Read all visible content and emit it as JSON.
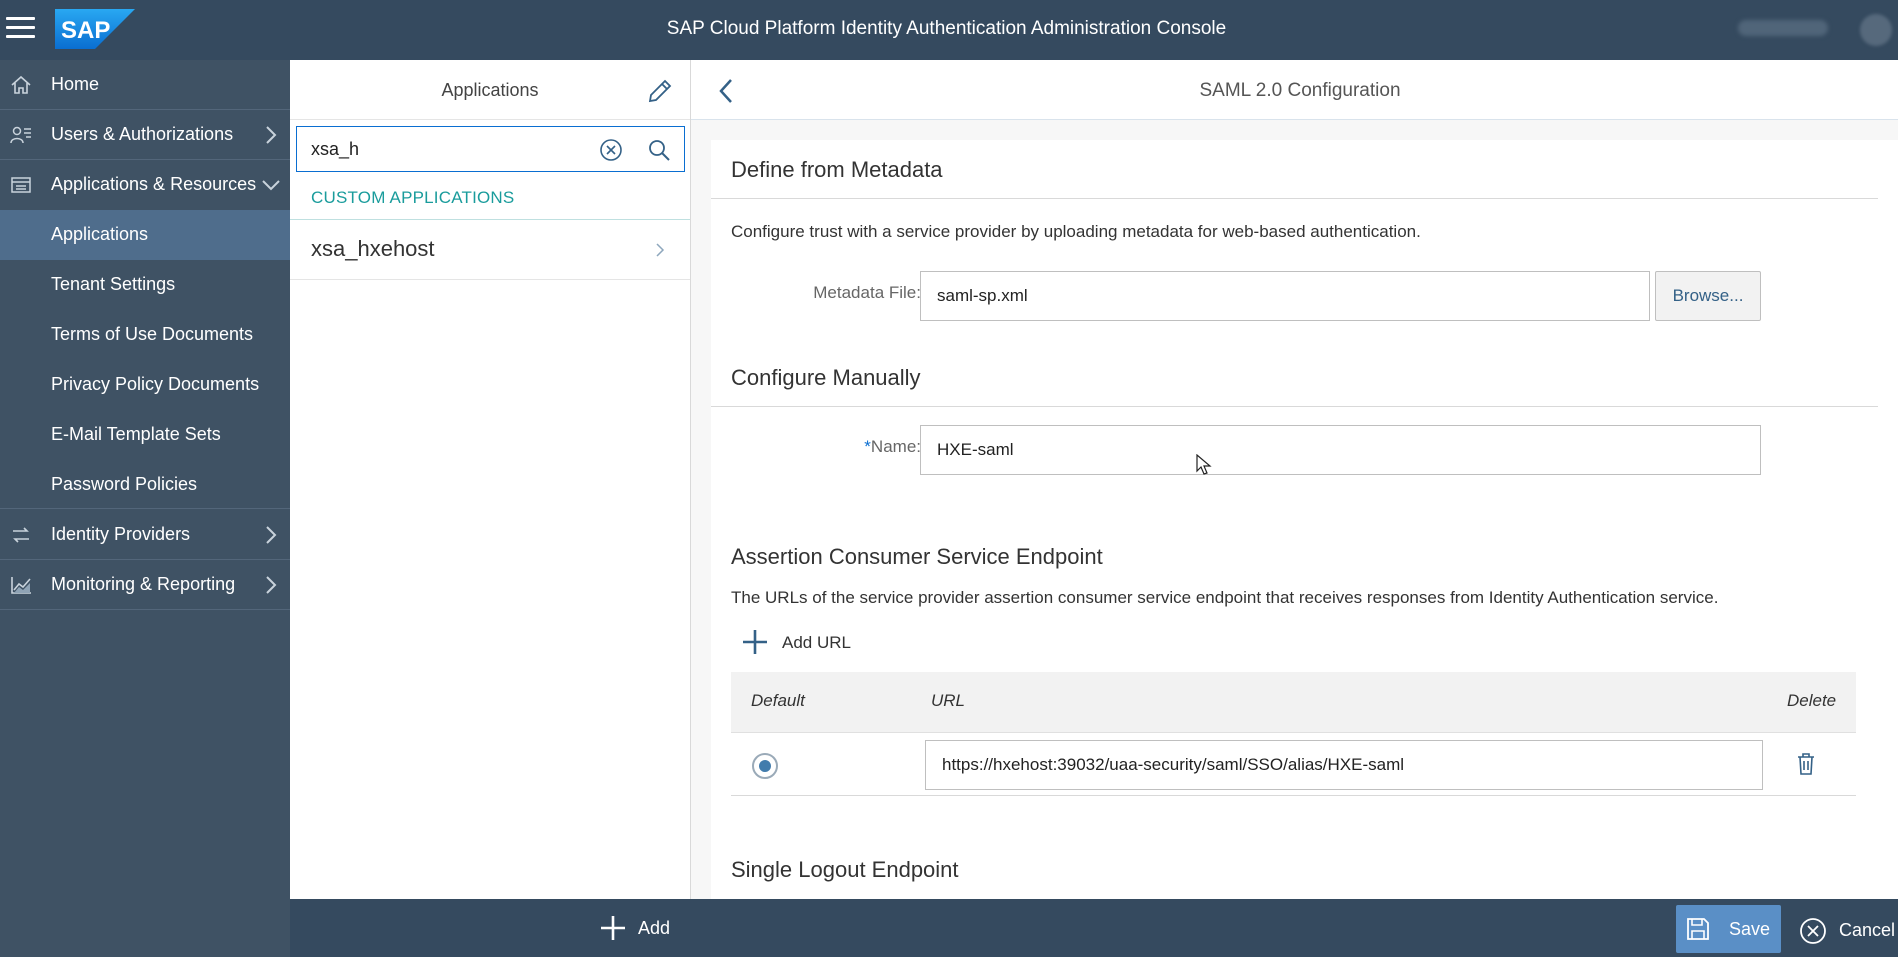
{
  "topbar": {
    "logo_text": "SAP",
    "title": "SAP Cloud Platform Identity Authentication Administration Console",
    "menu_icon": "hamburger-icon",
    "colors": {
      "shell": "#354a5f",
      "logo": "#1f8fe0"
    }
  },
  "sidebar": {
    "items": [
      {
        "label": "Home",
        "icon": "home-icon"
      },
      {
        "label": "Users & Authorizations",
        "icon": "users-icon",
        "chevron": "chevron-right-icon"
      },
      {
        "label": "Applications & Resources",
        "icon": "applications-icon",
        "chevron": "chevron-down-icon",
        "expanded": true
      },
      {
        "label": "Identity Providers",
        "icon": "identity-providers-icon",
        "chevron": "chevron-right-icon"
      },
      {
        "label": "Monitoring & Reporting",
        "icon": "monitoring-icon",
        "chevron": "chevron-right-icon"
      }
    ],
    "subitems": [
      {
        "label": "Applications",
        "active": true
      },
      {
        "label": "Tenant Settings"
      },
      {
        "label": "Terms of Use Documents"
      },
      {
        "label": "Privacy Policy Documents"
      },
      {
        "label": "E-Mail Template Sets"
      },
      {
        "label": "Password Policies"
      }
    ],
    "colors": {
      "background": "#3f5264",
      "active": "#4f6d8c"
    }
  },
  "list_panel": {
    "title": "Applications",
    "search_value": "xsa_h",
    "group_header": "CUSTOM APPLICATIONS",
    "items": [
      {
        "label": "xsa_hxehost"
      }
    ],
    "add_label": "Add",
    "colors": {
      "group_header": "#1a9c9c",
      "search_border": "#0a6ed1"
    }
  },
  "detail": {
    "title": "SAML 2.0 Configuration",
    "metadata_section": {
      "title": "Define from Metadata",
      "description": "Configure trust with a service provider by uploading metadata for web-based authentication.",
      "file_label": "Metadata File:",
      "file_value": "saml-sp.xml",
      "browse_label": "Browse..."
    },
    "manual_section": {
      "title": "Configure Manually",
      "required_mark": "*",
      "name_label": "Name:",
      "name_value": "HXE-saml"
    },
    "acs_section": {
      "title": "Assertion Consumer Service Endpoint",
      "description": "The URLs of the service provider assertion consumer service endpoint that receives responses from Identity Authentication service.",
      "add_url_label": "Add URL",
      "columns": {
        "default": "Default",
        "url": "URL",
        "delete": "Delete"
      },
      "rows": [
        {
          "default": true,
          "url": "https://hxehost:39032/uaa-security/saml/SSO/alias/HXE-saml"
        }
      ]
    },
    "slo_section": {
      "title": "Single Logout Endpoint"
    }
  },
  "footer": {
    "save_label": "Save",
    "cancel_label": "Cancel",
    "colors": {
      "save": "#5a8fc6"
    }
  }
}
